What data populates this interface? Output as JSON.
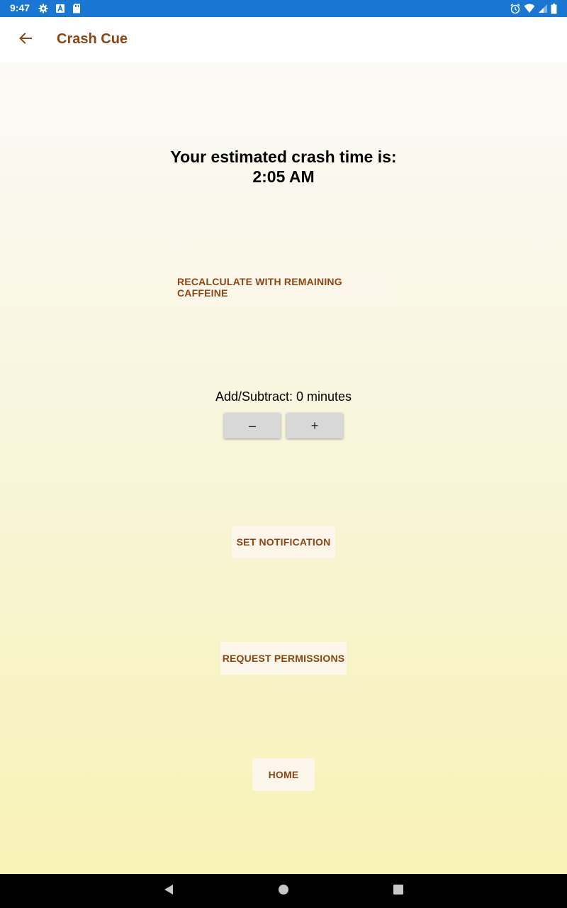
{
  "status_bar": {
    "time": "9:47",
    "left_icons": [
      "settings-icon",
      "a-icon",
      "sd-card-icon"
    ],
    "right_icons": [
      "alarm-icon",
      "wifi-icon",
      "signal-icon",
      "battery-icon"
    ],
    "color": "#1976d2"
  },
  "app_bar": {
    "title": "Crash Cue",
    "back_icon": "arrow-back-icon",
    "title_color": "#8b4513"
  },
  "main": {
    "crash_title": "Your estimated crash time is:",
    "crash_time": "2:05 AM",
    "recalculate_label": "RECALCULATE WITH REMAINING CAFFEINE",
    "adjust_label": "Add/Subtract: 0 minutes",
    "minus_label": "–",
    "plus_label": "+",
    "notify_label": "SET NOTIFICATION",
    "permissions_label": "REQUEST PERMISSIONS",
    "home_label": "HOME"
  },
  "nav_bar": {
    "icons": [
      "nav-back-icon",
      "nav-home-icon",
      "nav-recents-icon"
    ]
  }
}
